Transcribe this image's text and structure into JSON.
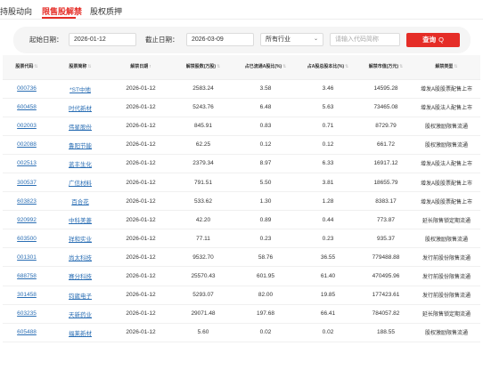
{
  "tabs": [
    "持股动向",
    "限售股解禁",
    "股权质押"
  ],
  "filter": {
    "start_label": "起始日期：",
    "start_value": "2026-01-12",
    "end_label": "截止日期：",
    "end_value": "2026-03-09",
    "industry": "所有行业",
    "search_placeholder": "请输入代码简称",
    "query_label": "查询",
    "query_icon": "search-icon"
  },
  "table": {
    "headers": [
      {
        "label": "股票代码",
        "sort": "none"
      },
      {
        "label": "股票简称",
        "sort": "none"
      },
      {
        "label": "解禁日期",
        "sort": "asc"
      },
      {
        "label": "解禁股数(万股)",
        "sort": "none"
      },
      {
        "label": "占已流通A股比(%)",
        "sort": "none"
      },
      {
        "label": "占A股总股本比(%)",
        "sort": "none"
      },
      {
        "label": "解禁市值(万元)",
        "sort": "none"
      },
      {
        "label": "解禁类型",
        "sort": "none"
      }
    ],
    "rows": [
      [
        "000736",
        "*ST中地",
        "2026-01-12",
        "2583.24",
        "3.58",
        "3.46",
        "14595.28",
        "增发A股股票配售上市"
      ],
      [
        "600458",
        "时代新材",
        "2026-01-12",
        "5243.76",
        "6.48",
        "5.63",
        "73465.08",
        "增发A股法人配售上市"
      ],
      [
        "002003",
        "伟星股份",
        "2026-01-12",
        "845.91",
        "0.83",
        "0.71",
        "8729.79",
        "股权激励限售流通"
      ],
      [
        "002088",
        "鲁阳节能",
        "2026-01-12",
        "62.25",
        "0.12",
        "0.12",
        "661.72",
        "股权激励限售流通"
      ],
      [
        "002513",
        "蓝丰生化",
        "2026-01-12",
        "2379.34",
        "8.97",
        "6.33",
        "16917.12",
        "增发A股法人配售上市"
      ],
      [
        "300537",
        "广信材料",
        "2026-01-12",
        "791.51",
        "5.50",
        "3.81",
        "18655.79",
        "增发A股股票配售上市"
      ],
      [
        "603823",
        "百合花",
        "2026-01-12",
        "533.62",
        "1.30",
        "1.28",
        "8383.17",
        "增发A股股票配售上市"
      ],
      [
        "920992",
        "中科美菱",
        "2026-01-12",
        "42.20",
        "0.89",
        "0.44",
        "773.87",
        "延长限售锁定期流通"
      ],
      [
        "603500",
        "祥和实业",
        "2026-01-12",
        "77.11",
        "0.23",
        "0.23",
        "935.37",
        "股权激励限售流通"
      ],
      [
        "001301",
        "尚太科技",
        "2026-01-12",
        "9532.70",
        "58.76",
        "36.55",
        "779488.88",
        "发行前股份限售流通"
      ],
      [
        "688758",
        "赛分科技",
        "2026-01-12",
        "25570.43",
        "601.95",
        "61.40",
        "470495.96",
        "发行前股份限售流通"
      ],
      [
        "301458",
        "钧崴电子",
        "2026-01-12",
        "5293.07",
        "82.00",
        "19.85",
        "177423.61",
        "发行前股份限售流通"
      ],
      [
        "603235",
        "天新药业",
        "2026-01-12",
        "29071.48",
        "197.68",
        "66.41",
        "784057.82",
        "延长限售锁定期流通"
      ],
      [
        "605488",
        "福莱新材",
        "2026-01-12",
        "5.60",
        "0.02",
        "0.02",
        "188.55",
        "股权激励限售流通"
      ]
    ]
  }
}
